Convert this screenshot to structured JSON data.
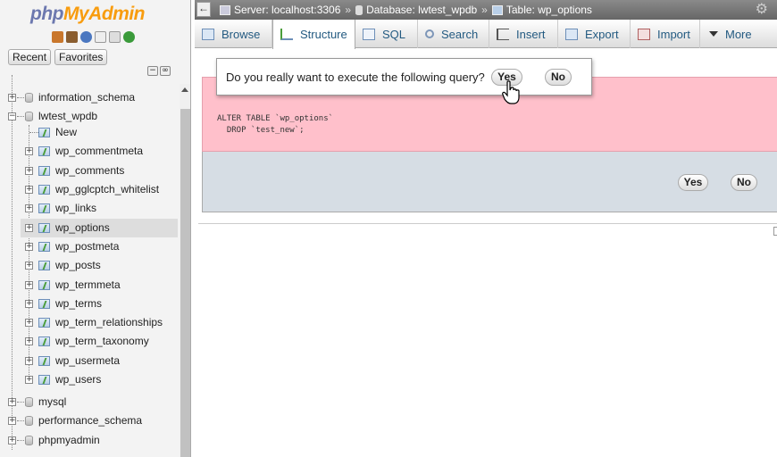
{
  "logo": {
    "part1": "php",
    "part2": "MyAdmin"
  },
  "nav": {
    "quick_icons": [
      "home-icon",
      "exit-icon",
      "help-icon",
      "docs-icon",
      "settings-icon",
      "reload-icon"
    ],
    "tabs": [
      "Recent",
      "Favorites"
    ],
    "collapse": "−",
    "link": "∞",
    "tree": {
      "db_information_schema": "information_schema",
      "db_lwtest": "lwtest_wpdb",
      "new": "New",
      "tables": [
        "wp_commentmeta",
        "wp_comments",
        "wp_gglcptch_whitelist",
        "wp_links",
        "wp_options",
        "wp_postmeta",
        "wp_posts",
        "wp_termmeta",
        "wp_terms",
        "wp_term_relationships",
        "wp_term_taxonomy",
        "wp_usermeta",
        "wp_users"
      ],
      "selected_table": "wp_options",
      "db_mysql": "mysql",
      "db_performance": "performance_schema",
      "db_phpmyadmin": "phpmyadmin"
    }
  },
  "breadcrumb": {
    "server": "Server: localhost:3306",
    "sep": "»",
    "database": "Database: lwtest_wpdb",
    "table": "Table: wp_options"
  },
  "menu": {
    "tabs": [
      "Browse",
      "Structure",
      "SQL",
      "Search",
      "Insert",
      "Export",
      "Import",
      "More"
    ],
    "active": "Structure"
  },
  "confirm": {
    "question": "Do you really want to execute the following query?",
    "yes": "Yes",
    "no": "No"
  },
  "query": {
    "line1": "ALTER TABLE `wp_options`",
    "line2": "  DROP `test_new`;"
  },
  "actions": {
    "yes": "Yes",
    "no": "No"
  },
  "colors": {
    "error_bg": "#ffc0cb",
    "action_bg": "#d6dde4",
    "link": "#235a81",
    "logo_php": "#6c78af",
    "logo_myadmin": "#f89c0e"
  }
}
